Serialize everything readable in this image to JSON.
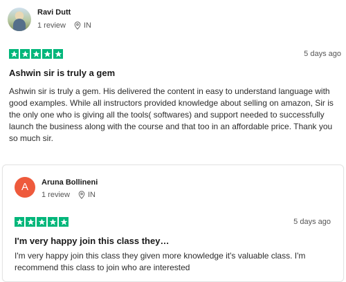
{
  "colors": {
    "star_green": "#00b67a",
    "avatar_orange": "#ee5a3c"
  },
  "reviews": [
    {
      "reviewer": "Ravi Dutt",
      "review_count": "1 review",
      "country": "IN",
      "avatar_icon": "user-photo",
      "rating": 5,
      "date": "5 days ago",
      "title": "Ashwin sir is truly a gem",
      "body": "Ashwin sir is truly a gem. His delivered the content in easy to understand language with good examples. While all instructors provided knowledge about selling on amazon, Sir is the only one who is giving all the tools( softwares) and support needed to successfully launch the business along with the course and that too in an affordable price. Thank you so much sir."
    },
    {
      "reviewer": "Aruna Bollineni",
      "avatar_letter": "A",
      "review_count": "1 review",
      "country": "IN",
      "rating": 5,
      "date": "5 days ago",
      "title": "I'm very happy join this class they…",
      "body": "I'm very happy join this class they given more knowledge it's valuable class. I'm recommend this class to join who are interested"
    }
  ]
}
